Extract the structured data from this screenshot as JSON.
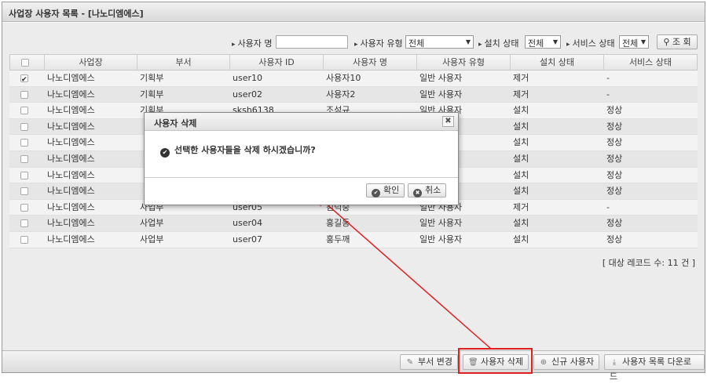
{
  "window": {
    "title": "사업장 사용자 목록 - [나노디엠에스]"
  },
  "search": {
    "user_name_label": "사용자 명",
    "user_name_value": "",
    "user_type_label": "사용자 유형",
    "user_type_value": "전체",
    "install_status_label": "설치 상태",
    "install_status_value": "전체",
    "service_status_label": "서비스 상태",
    "service_status_value": "전체",
    "search_button": "조 회"
  },
  "table": {
    "headers": [
      "",
      "사업장",
      "부서",
      "사용자 ID",
      "사용자 명",
      "사용자 유형",
      "설치 상태",
      "서비스 상태"
    ],
    "rows": [
      {
        "checked": true,
        "site": "나노디엠에스",
        "dept": "기획부",
        "id": "user10",
        "name": "사용자10",
        "type": "일반 사용자",
        "install": "제거",
        "service": "-"
      },
      {
        "checked": false,
        "site": "나노디엠에스",
        "dept": "기획부",
        "id": "user02",
        "name": "사용자2",
        "type": "일반 사용자",
        "install": "제거",
        "service": "-"
      },
      {
        "checked": false,
        "site": "나노디엠에스",
        "dept": "기획부",
        "id": "sksh6138",
        "name": "조성규",
        "type": "일반 사용자",
        "install": "설치",
        "service": "정상"
      },
      {
        "checked": false,
        "site": "나노디엠에스",
        "dept": "",
        "id": "",
        "name": "",
        "type": "",
        "install": "설치",
        "service": "정상"
      },
      {
        "checked": false,
        "site": "나노디엠에스",
        "dept": "",
        "id": "",
        "name": "",
        "type": "",
        "install": "설치",
        "service": "정상"
      },
      {
        "checked": false,
        "site": "나노디엠에스",
        "dept": "",
        "id": "",
        "name": "",
        "type": "",
        "install": "설치",
        "service": "정상"
      },
      {
        "checked": false,
        "site": "나노디엠에스",
        "dept": "",
        "id": "",
        "name": "",
        "type": "",
        "install": "설치",
        "service": "정상"
      },
      {
        "checked": false,
        "site": "나노디엠에스",
        "dept": "",
        "id": "",
        "name": "",
        "type": "",
        "install": "설치",
        "service": "정상"
      },
      {
        "checked": false,
        "site": "나노디엠에스",
        "dept": "사업부",
        "id": "user05",
        "name": "김덕중",
        "type": "일반 사용자",
        "install": "제거",
        "service": "-"
      },
      {
        "checked": false,
        "site": "나노디엠에스",
        "dept": "사업부",
        "id": "user04",
        "name": "홍길동",
        "type": "일반 사용자",
        "install": "설치",
        "service": "정상"
      },
      {
        "checked": false,
        "site": "나노디엠에스",
        "dept": "사업부",
        "id": "user07",
        "name": "홍두깨",
        "type": "일반 사용자",
        "install": "설치",
        "service": "정상"
      }
    ]
  },
  "record_count": "[ 대상 레코드 수: 11 건 ]",
  "footer": {
    "change_dept": "부서 변경",
    "delete_user": "사용자 삭제",
    "new_user": "신규 사용자",
    "download_list": "사용자 목록 다운로드"
  },
  "dialog": {
    "title": "사용자 삭제",
    "message": "선택한 사용자들을 삭제 하시겠습니까?",
    "ok": "확인",
    "cancel": "취소"
  },
  "colors": {
    "highlight": "#e02020"
  }
}
